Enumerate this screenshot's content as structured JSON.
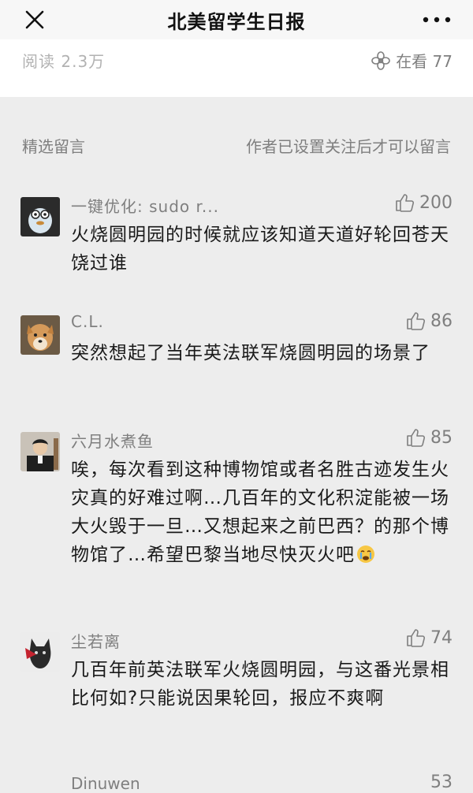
{
  "header": {
    "title": "北美留学生日报",
    "close_icon": "close-icon",
    "more_icon": "more-dots-icon"
  },
  "article": {
    "read_count": "阅读 2.3万",
    "watching_label": "在看 77",
    "watching_icon": "flower-icon"
  },
  "comments_section": {
    "title": "精选留言",
    "note": "作者已设置关注后才可以留言"
  },
  "comments": [
    {
      "nickname": "一键优化: sudo r...",
      "likes": "200",
      "text": "火烧圆明园的时候就应该知道天道好轮回苍天饶过谁"
    },
    {
      "nickname": "C.L.",
      "likes": "86",
      "text": "突然想起了当年英法联军烧圆明园的场景了"
    },
    {
      "nickname": "六月水煮鱼",
      "likes": "85",
      "text": "唉，每次看到这种博物馆或者名胜古迹发生火灾真的好难过啊…几百年的文化积淀能被一场大火毁于一旦…又想起来之前巴西？的那个博物馆了…希望巴黎当地尽快灭火吧"
    },
    {
      "nickname": "尘若离",
      "likes": "74",
      "text": "几百年前英法联军火烧圆明园，与这番光景相比何如?只能说因果轮回，报应不爽啊"
    }
  ],
  "partial_comment": {
    "nickname": "Dinuwen",
    "likes": "53"
  },
  "colors": {
    "background": "#ededed",
    "text": "#1a1a1a",
    "muted": "#7f7f7f"
  }
}
